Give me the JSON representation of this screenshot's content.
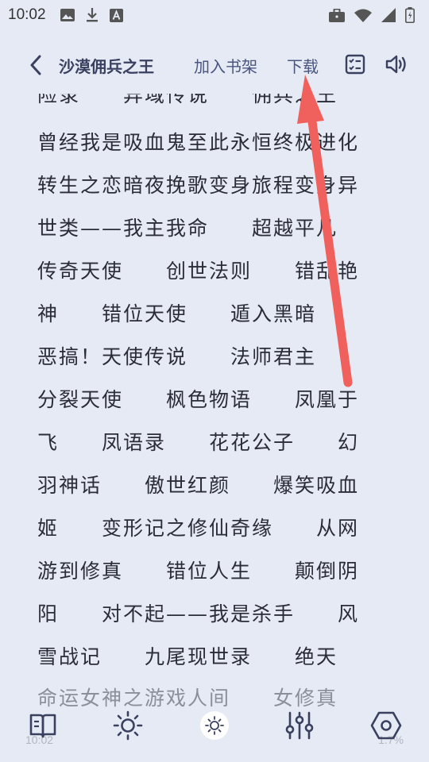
{
  "status_bar": {
    "time": "10:02",
    "left_icons": [
      "image-icon",
      "download-icon",
      "text-a-icon"
    ],
    "right_icons": [
      "briefcase-icon",
      "wifi-icon",
      "signal-icon",
      "battery-icon"
    ]
  },
  "toolbar": {
    "back_icon": "chevron-left-icon",
    "title": "沙漠佣兵之王",
    "add_shelf": "加入书架",
    "download": "下载",
    "checklist_icon": "checklist-icon",
    "audio_icon": "speaker-icon"
  },
  "reading": {
    "lines": [
      "险录　　异域传说　　佣兵之王",
      "曾经我是吸血鬼至此永恒终极进化",
      "转生之恋暗夜挽歌变身旅程变身异",
      "世类——我主我命　　超越平凡",
      "传奇天使　　创世法则　　错乱艳",
      "神　　错位天使　　遁入黑暗",
      "恶搞！天使传说　　法师君主",
      "分裂天使　　枫色物语　　凤凰于",
      "飞　　凤语录　　花花公子　　幻",
      "羽神话　　傲世红颜　　爆笑吸血",
      "姬　　变形记之修仙奇缘　　从网",
      "游到修真　　错位人生　　颠倒阴",
      "阳　　对不起——我是杀手　　风",
      "雪战记　　九尾现世录　　绝天",
      "命运女神之游戏人间　　女修真"
    ]
  },
  "bottom_bar": {
    "time": "10:02",
    "progress": "1.7%",
    "icons": [
      "book-icon",
      "brightness-icon",
      "brightness-small-icon",
      "sliders-icon",
      "settings-icon"
    ]
  },
  "colors": {
    "background": "#e6eaf4",
    "title": "#3a4060",
    "link": "#4a5680",
    "arrow": "#f0605c"
  }
}
